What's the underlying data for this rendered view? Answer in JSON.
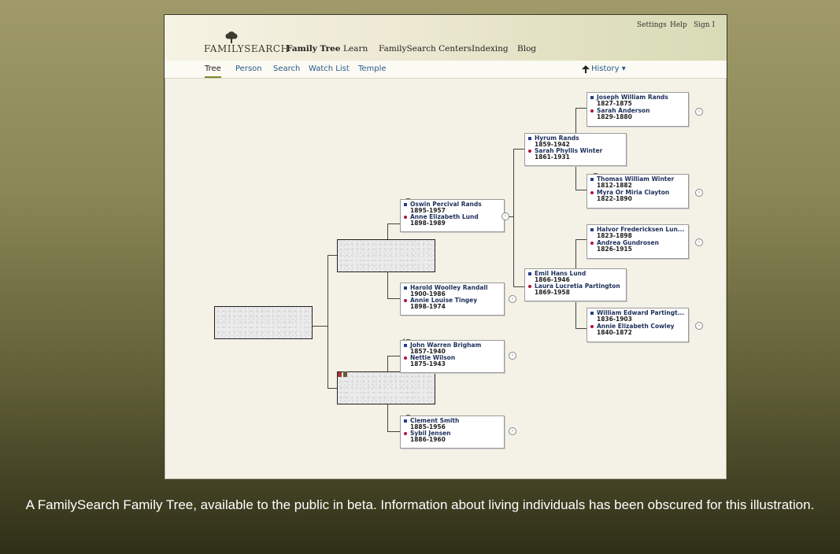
{
  "header": {
    "logo": "FAMILYSEARCH",
    "nav": [
      "Family Tree",
      "Learn",
      "FamilySearch Centers",
      "Indexing",
      "Blog"
    ],
    "links": [
      "Settings",
      "Help",
      "Sign I"
    ]
  },
  "subnav": {
    "tabs": [
      "Tree",
      "Person",
      "Search",
      "Watch List",
      "Temple"
    ],
    "history": "History ▾"
  },
  "people": {
    "oswin": {
      "name": "Oswin Percival Rands",
      "dates": "1895-1957"
    },
    "anne_e": {
      "name": "Anne Elizabeth Lund",
      "dates": "1898-1989"
    },
    "harold": {
      "name": "Harold Woolley Randall",
      "dates": "1900-1986"
    },
    "annie_l": {
      "name": "Annie Louise Tingey",
      "dates": "1898-1974"
    },
    "john": {
      "name": "John Warren Brigham",
      "dates": "1857-1940"
    },
    "nettie": {
      "name": "Nettie Wilson",
      "dates": "1875-1943"
    },
    "clement": {
      "name": "Clement Smith",
      "dates": "1885-1956"
    },
    "sybil": {
      "name": "Sybil Jensen",
      "dates": "1886-1960"
    },
    "hyrum": {
      "name": "Hyrum Rands",
      "dates": "1859-1942"
    },
    "sarah_w": {
      "name": "Sarah Phyllis Winter",
      "dates": "1861-1931"
    },
    "emil": {
      "name": "Emil Hans Lund",
      "dates": "1866-1946"
    },
    "laura": {
      "name": "Laura Lucretia Partington",
      "dates": "1869-1958"
    },
    "joseph": {
      "name": "Joseph William Rands",
      "dates": "1827-1875"
    },
    "sarah_a": {
      "name": "Sarah Anderson",
      "dates": "1829-1880"
    },
    "thomas": {
      "name": "Thomas William Winter",
      "dates": "1812-1882"
    },
    "myra": {
      "name": "Myra Or Miria Clayton",
      "dates": "1822-1890"
    },
    "halvor": {
      "name": "Halvor Fredericksen Lun...",
      "dates": "1823-1898"
    },
    "andrea": {
      "name": "Andrea Gundrosen",
      "dates": "1826-1915"
    },
    "william": {
      "name": "William Edward Partingt...",
      "dates": "1836-1903"
    },
    "annie_c": {
      "name": "Annie Elizabeth Cowley",
      "dates": "1840-1872"
    }
  },
  "caption": "A FamilySearch Family Tree, available to the public in beta. Information about living individuals has been obscured for this illustration."
}
